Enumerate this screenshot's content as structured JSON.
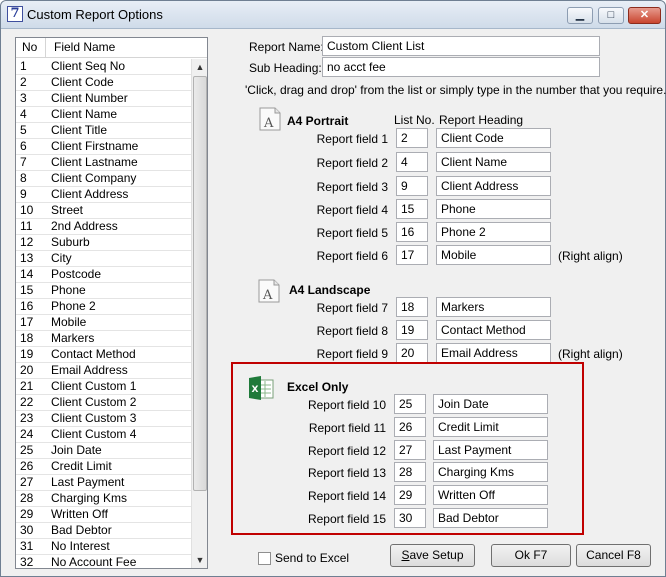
{
  "window": {
    "title": "Custom Report Options",
    "icon_glyph": "7",
    "min_glyph": "▁",
    "max_glyph": "□",
    "close_glyph": "✕"
  },
  "list": {
    "col_no": "No",
    "col_name": "Field Name",
    "up_glyph": "▲",
    "down_glyph": "▼",
    "rows": [
      [
        "1",
        "Client Seq No"
      ],
      [
        "2",
        "Client Code"
      ],
      [
        "3",
        "Client Number"
      ],
      [
        "4",
        "Client Name"
      ],
      [
        "5",
        "Client Title"
      ],
      [
        "6",
        "Client Firstname"
      ],
      [
        "7",
        "Client Lastname"
      ],
      [
        "8",
        "Client Company"
      ],
      [
        "9",
        "Client Address"
      ],
      [
        "10",
        "Street"
      ],
      [
        "11",
        "2nd Address"
      ],
      [
        "12",
        "Suburb"
      ],
      [
        "13",
        "City"
      ],
      [
        "14",
        "Postcode"
      ],
      [
        "15",
        "Phone"
      ],
      [
        "16",
        "Phone 2"
      ],
      [
        "17",
        "Mobile"
      ],
      [
        "18",
        "Markers"
      ],
      [
        "19",
        "Contact Method"
      ],
      [
        "20",
        "Email Address"
      ],
      [
        "21",
        "Client Custom 1"
      ],
      [
        "22",
        "Client Custom 2"
      ],
      [
        "23",
        "Client Custom 3"
      ],
      [
        "24",
        "Client Custom 4"
      ],
      [
        "25",
        "Join Date"
      ],
      [
        "26",
        "Credit Limit"
      ],
      [
        "27",
        "Last Payment"
      ],
      [
        "28",
        "Charging Kms"
      ],
      [
        "29",
        "Written Off"
      ],
      [
        "30",
        "Bad Debtor"
      ],
      [
        "31",
        "No Interest"
      ],
      [
        "32",
        "No Account Fee"
      ]
    ]
  },
  "form": {
    "report_name_label": "Report Name:",
    "report_name": "Custom Client List",
    "sub_heading_label": "Sub Heading:",
    "sub_heading": "no acct fee",
    "instructions": "'Click, drag and drop' from the list or simply type in the number that you require.",
    "list_no_header": "List No.",
    "report_heading_header": "Report Heading"
  },
  "portrait": {
    "title": "A4 Portrait",
    "fields": [
      {
        "label": "Report field 1",
        "no": "2",
        "heading": "Client Code"
      },
      {
        "label": "Report field 2",
        "no": "4",
        "heading": "Client Name"
      },
      {
        "label": "Report field 3",
        "no": "9",
        "heading": "Client Address"
      },
      {
        "label": "Report field 4",
        "no": "15",
        "heading": "Phone"
      },
      {
        "label": "Report field 5",
        "no": "16",
        "heading": "Phone 2"
      },
      {
        "label": "Report field 6",
        "no": "17",
        "heading": "Mobile",
        "note": "(Right align)"
      }
    ]
  },
  "landscape": {
    "title": "A4 Landscape",
    "fields": [
      {
        "label": "Report field 7",
        "no": "18",
        "heading": "Markers"
      },
      {
        "label": "Report field 8",
        "no": "19",
        "heading": "Contact Method"
      },
      {
        "label": "Report field 9",
        "no": "20",
        "heading": "Email Address",
        "note": "(Right align)"
      }
    ]
  },
  "excel": {
    "title": "Excel Only",
    "fields": [
      {
        "label": "Report field 10",
        "no": "25",
        "heading": "Join Date"
      },
      {
        "label": "Report field 11",
        "no": "26",
        "heading": "Credit Limit"
      },
      {
        "label": "Report field 12",
        "no": "27",
        "heading": "Last Payment"
      },
      {
        "label": "Report field 13",
        "no": "28",
        "heading": "Charging Kms"
      },
      {
        "label": "Report field 14",
        "no": "29",
        "heading": "Written Off"
      },
      {
        "label": "Report field 15",
        "no": "30",
        "heading": "Bad Debtor"
      }
    ]
  },
  "footer": {
    "send_to_excel": "Send to Excel",
    "save_first": "S",
    "save_rest": "ave Setup",
    "ok": "Ok F7",
    "cancel": "Cancel F8"
  },
  "colors": {
    "highlight_box": "#c00000",
    "excel_green": "#1f7a3a"
  }
}
